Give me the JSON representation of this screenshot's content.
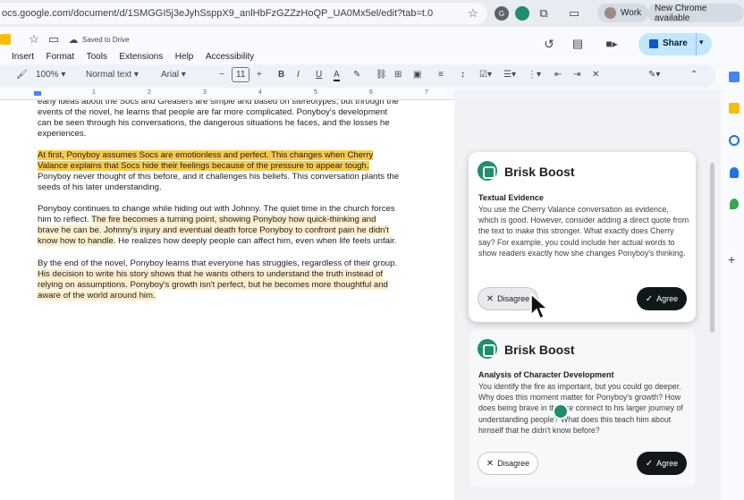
{
  "browser": {
    "url": "ocs.google.com/document/d/1SMGGI5j3eJyhSsppX9_anlHbFzGZZzHoQP_UA0Mx5el/edit?tab=t.0",
    "profile": "Work",
    "update_chip": "New Chrome available"
  },
  "docs": {
    "saved_status": "Saved to Drive",
    "menu": [
      "Insert",
      "Format",
      "Tools",
      "Extensions",
      "Help",
      "Accessibility"
    ],
    "share_label": "Share",
    "toolbar": {
      "zoom": "100%",
      "style": "Normal text",
      "font": "Arial",
      "font_size": "11",
      "bold": "B",
      "italic": "I",
      "underline": "U",
      "text_color": "A"
    },
    "ruler": [
      "1",
      "2",
      "3",
      "4",
      "5",
      "6",
      "7"
    ]
  },
  "document": {
    "p1": "early ideas about the Socs and Greasers are simple and based on stereotypes, but through the events of the novel, he learns that people are far more complicated. Ponyboy's development can be seen through his conversations, the dangerous situations he faces, and the losses he experiences.",
    "p2_highlight": "At first, Ponyboy assumes Socs are emotionless and perfect. This changes when Cherry Valance explains that Socs hide their feelings because of the pressure to appear tough.",
    "p2_rest": " Ponyboy never thought of this before, and it challenges his beliefs. This conversation plants the seeds of his later understanding.",
    "p3_start": "Ponyboy continues to change while hiding out with Johnny. The quiet time in the church forces him to reflect. ",
    "p3_highlight": "The fire becomes a turning point, showing Ponyboy how quick-thinking and brave he can be. Johnny's injury and eventual death force Ponyboy to confront pain he didn't know how to handle.",
    "p3_end": " He realizes how deeply people can affect him, even when life feels unfair.",
    "p4_start": "By the end of the novel, Ponyboy learns that everyone has struggles, regardless of their group. ",
    "p4_highlight": "His decision to write his story shows that he wants others to understand the truth instead of relying on assumptions. Ponyboy's growth isn't perfect, but he becomes more thoughtful and aware of the world around him."
  },
  "panel": {
    "cards": [
      {
        "title": "Brisk Boost",
        "subtitle": "Textual Evidence",
        "body": "You use the Cherry Valance conversation as evidence, which is good. However, consider adding a direct quote from the text to make this stronger. What exactly does Cherry say? For example, you could include her actual words to show readers exactly how she changes Ponyboy's thinking.",
        "disagree": "Disagree",
        "agree": "Agree"
      },
      {
        "title": "Brisk Boost",
        "subtitle": "Analysis of Character Development",
        "body": "You identify the fire as important, but you could go deeper. Why does this moment matter for Ponyboy's growth? How does being brave in the fire connect to his larger journey of understanding people? What does this teach him about himself that he didn't know before?",
        "disagree": "Disagree",
        "agree": "Agree"
      }
    ]
  },
  "colors": {
    "highlight_strong": "#f8c94a",
    "highlight_soft": "#fdeecb",
    "brisk_green": "#1e8e6e",
    "share_blue": "#c2e7ff"
  }
}
